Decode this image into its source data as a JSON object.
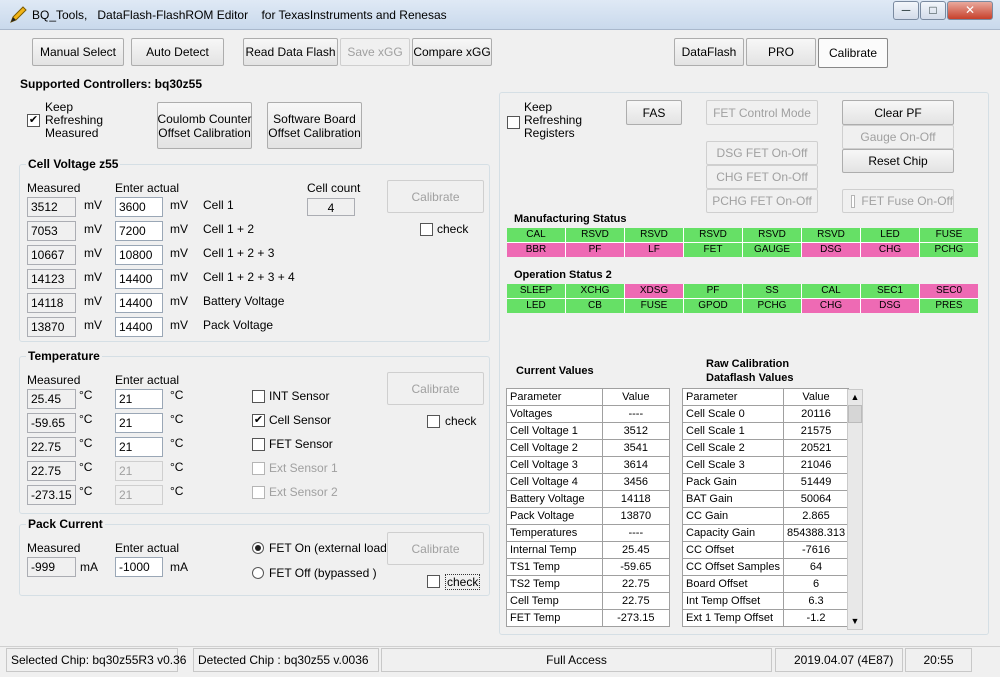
{
  "window": {
    "app_name": "BQ_Tools,",
    "title_rest": "DataFlash-FlashROM Editor",
    "title_vendor": "for TexasInstruments and Renesas",
    "min_label": "─",
    "max_label": "□",
    "close_label": "✕"
  },
  "toolbar": {
    "manual_select": "Manual Select",
    "auto_detect": "Auto Detect",
    "read_data_flash": "Read Data Flash",
    "save_xgg": "Save xGG",
    "compare_xgg": "Compare xGG",
    "tab_dataflash": "DataFlash",
    "tab_pro": "PRO",
    "tab_calibrate": "Calibrate"
  },
  "supported_controllers": "Supported Controllers: bq30z55",
  "keep_refreshing": {
    "line1": "Keep",
    "line2": "Refreshing",
    "line3": "Measured",
    "checked": true
  },
  "coulomb_btn": {
    "line1": "Coulomb Counter",
    "line2": "Offset Calibration"
  },
  "software_btn": {
    "line1": "Software Board",
    "line2": "Offset Calibration"
  },
  "cell_voltage": {
    "title": "Cell Voltage z55",
    "measured_hdr": "Measured",
    "enter_hdr": "Enter actual",
    "cell_count_label": "Cell count",
    "cell_count": "4",
    "calibrate": "Calibrate",
    "check": "check",
    "rows": [
      {
        "measured": "3512",
        "unit": "mV",
        "actual": "3600",
        "unit2": "mV",
        "name": "Cell 1"
      },
      {
        "measured": "7053",
        "unit": "mV",
        "actual": "7200",
        "unit2": "mV",
        "name": "Cell 1 + 2"
      },
      {
        "measured": "10667",
        "unit": "mV",
        "actual": "10800",
        "unit2": "mV",
        "name": "Cell 1 + 2 + 3"
      },
      {
        "measured": "14123",
        "unit": "mV",
        "actual": "14400",
        "unit2": "mV",
        "name": "Cell 1 + 2 + 3 + 4"
      },
      {
        "measured": "14118",
        "unit": "mV",
        "actual": "14400",
        "unit2": "mV",
        "name": "Battery  Voltage"
      },
      {
        "measured": "13870",
        "unit": "mV",
        "actual": "14400",
        "unit2": "mV",
        "name": "Pack    Voltage"
      }
    ]
  },
  "temperature": {
    "title": "Temperature",
    "measured_hdr": "Measured",
    "enter_hdr": "Enter actual",
    "calibrate": "Calibrate",
    "check": "check",
    "rows": [
      {
        "measured": "25.45",
        "unit": "°C",
        "actual": "21",
        "unit2": "°C",
        "sensor": "INT Sensor",
        "checked": false,
        "enabled": true
      },
      {
        "measured": "-59.65",
        "unit": "°C",
        "actual": "21",
        "unit2": "°C",
        "sensor": "Cell Sensor",
        "checked": true,
        "enabled": true
      },
      {
        "measured": "22.75",
        "unit": "°C",
        "actual": "21",
        "unit2": "°C",
        "sensor": "FET Sensor",
        "checked": false,
        "enabled": true
      },
      {
        "measured": "22.75",
        "unit": "°C",
        "actual": "21",
        "unit2": "°C",
        "sensor": "Ext Sensor 1",
        "checked": false,
        "enabled": false
      },
      {
        "measured": "-273.15",
        "unit": "°C",
        "actual": "21",
        "unit2": "°C",
        "sensor": "Ext Sensor 2",
        "checked": false,
        "enabled": false
      }
    ]
  },
  "pack_current": {
    "title": "Pack Current",
    "measured_hdr": "Measured",
    "enter_hdr": "Enter actual",
    "measured": "-999",
    "unit": "mA",
    "actual": "-1000",
    "unit2": "mA",
    "fet_on": "FET On (external load)",
    "fet_off": "FET Off (bypassed     )",
    "calibrate": "Calibrate",
    "check": "check"
  },
  "right_panel": {
    "keep_refreshing": {
      "line1": "Keep",
      "line2": "Refreshing",
      "line3": "Registers"
    },
    "fas": "FAS",
    "fet_control_mode": "FET Control Mode",
    "dsg_fet": "DSG   FET  On-Off",
    "chg_fet": "CHG   FET  On-Off",
    "pchg_fet": "PCHG  FET  On-Off",
    "clear_pf": "Clear PF",
    "gauge_onoff": "Gauge On-Off",
    "reset_chip": "Reset Chip",
    "fet_fuse": "FET Fuse On-Off",
    "manufacturing_status_title": "Manufacturing Status",
    "manufacturing_status": [
      {
        "t": "CAL",
        "c": "g"
      },
      {
        "t": "RSVD",
        "c": "g"
      },
      {
        "t": "RSVD",
        "c": "g"
      },
      {
        "t": "RSVD",
        "c": "g"
      },
      {
        "t": "RSVD",
        "c": "g"
      },
      {
        "t": "RSVD",
        "c": "g"
      },
      {
        "t": "LED",
        "c": "g"
      },
      {
        "t": "FUSE",
        "c": "g"
      },
      {
        "t": "BBR",
        "c": "p"
      },
      {
        "t": "PF",
        "c": "p"
      },
      {
        "t": "LF",
        "c": "p"
      },
      {
        "t": "FET",
        "c": "g"
      },
      {
        "t": "GAUGE",
        "c": "g"
      },
      {
        "t": "DSG",
        "c": "p"
      },
      {
        "t": "CHG",
        "c": "p"
      },
      {
        "t": "PCHG",
        "c": "g"
      }
    ],
    "operation_status_title": "Operation Status 2",
    "operation_status": [
      {
        "t": "SLEEP",
        "c": "g"
      },
      {
        "t": "XCHG",
        "c": "g"
      },
      {
        "t": "XDSG",
        "c": "p"
      },
      {
        "t": "PF",
        "c": "g"
      },
      {
        "t": "SS",
        "c": "g"
      },
      {
        "t": "CAL",
        "c": "g"
      },
      {
        "t": "SEC1",
        "c": "g"
      },
      {
        "t": "SEC0",
        "c": "p"
      },
      {
        "t": "LED",
        "c": "g"
      },
      {
        "t": "CB",
        "c": "g"
      },
      {
        "t": "FUSE",
        "c": "g"
      },
      {
        "t": "GPOD",
        "c": "g"
      },
      {
        "t": "PCHG",
        "c": "g"
      },
      {
        "t": "CHG",
        "c": "p"
      },
      {
        "t": "DSG",
        "c": "p"
      },
      {
        "t": "PRES",
        "c": "g"
      }
    ],
    "current_values_title": "Current Values",
    "raw_title_line1": "Raw    Calibration",
    "raw_title_line2": "Dataflash  Values",
    "current_values": {
      "header": [
        "Parameter",
        "Value"
      ],
      "rows": [
        [
          "Voltages",
          "----"
        ],
        [
          "Cell Voltage 1",
          "3512"
        ],
        [
          "Cell Voltage 2",
          "3541"
        ],
        [
          "Cell Voltage 3",
          "3614"
        ],
        [
          "Cell Voltage 4",
          "3456"
        ],
        [
          "Battery Voltage",
          "14118"
        ],
        [
          "Pack Voltage",
          "13870"
        ],
        [
          "Temperatures",
          "----"
        ],
        [
          "Internal Temp",
          "25.45"
        ],
        [
          "TS1 Temp",
          "-59.65"
        ],
        [
          "TS2 Temp",
          "22.75"
        ],
        [
          "Cell Temp",
          "22.75"
        ],
        [
          "FET Temp",
          "-273.15"
        ]
      ]
    },
    "raw_values": {
      "header": [
        "Parameter",
        "Value"
      ],
      "rows": [
        [
          "Cell Scale 0",
          "20116"
        ],
        [
          "Cell Scale 1",
          "21575"
        ],
        [
          "Cell Scale 2",
          "20521"
        ],
        [
          "Cell Scale 3",
          "21046"
        ],
        [
          "Pack Gain",
          "51449"
        ],
        [
          "BAT Gain",
          "50064"
        ],
        [
          "CC Gain",
          "2.865"
        ],
        [
          "Capacity Gain",
          "854388.313"
        ],
        [
          "CC Offset",
          "-7616"
        ],
        [
          "CC Offset Samples",
          "64"
        ],
        [
          "Board Offset",
          "6"
        ],
        [
          "Int Temp Offset",
          "6.3"
        ],
        [
          "Ext 1 Temp Offset",
          "-1.2"
        ]
      ]
    }
  },
  "statusbar": {
    "selected_chip": "Selected Chip:  bq30z55R3 v0.36",
    "detected_chip": "Detected Chip :  bq30z55  v.0036",
    "access": "Full Access",
    "date": "2019.04.07  (4E87)",
    "time": "20:55"
  },
  "colors": {
    "flag_green": "#66e066",
    "flag_pink": "#ee6ab4"
  }
}
